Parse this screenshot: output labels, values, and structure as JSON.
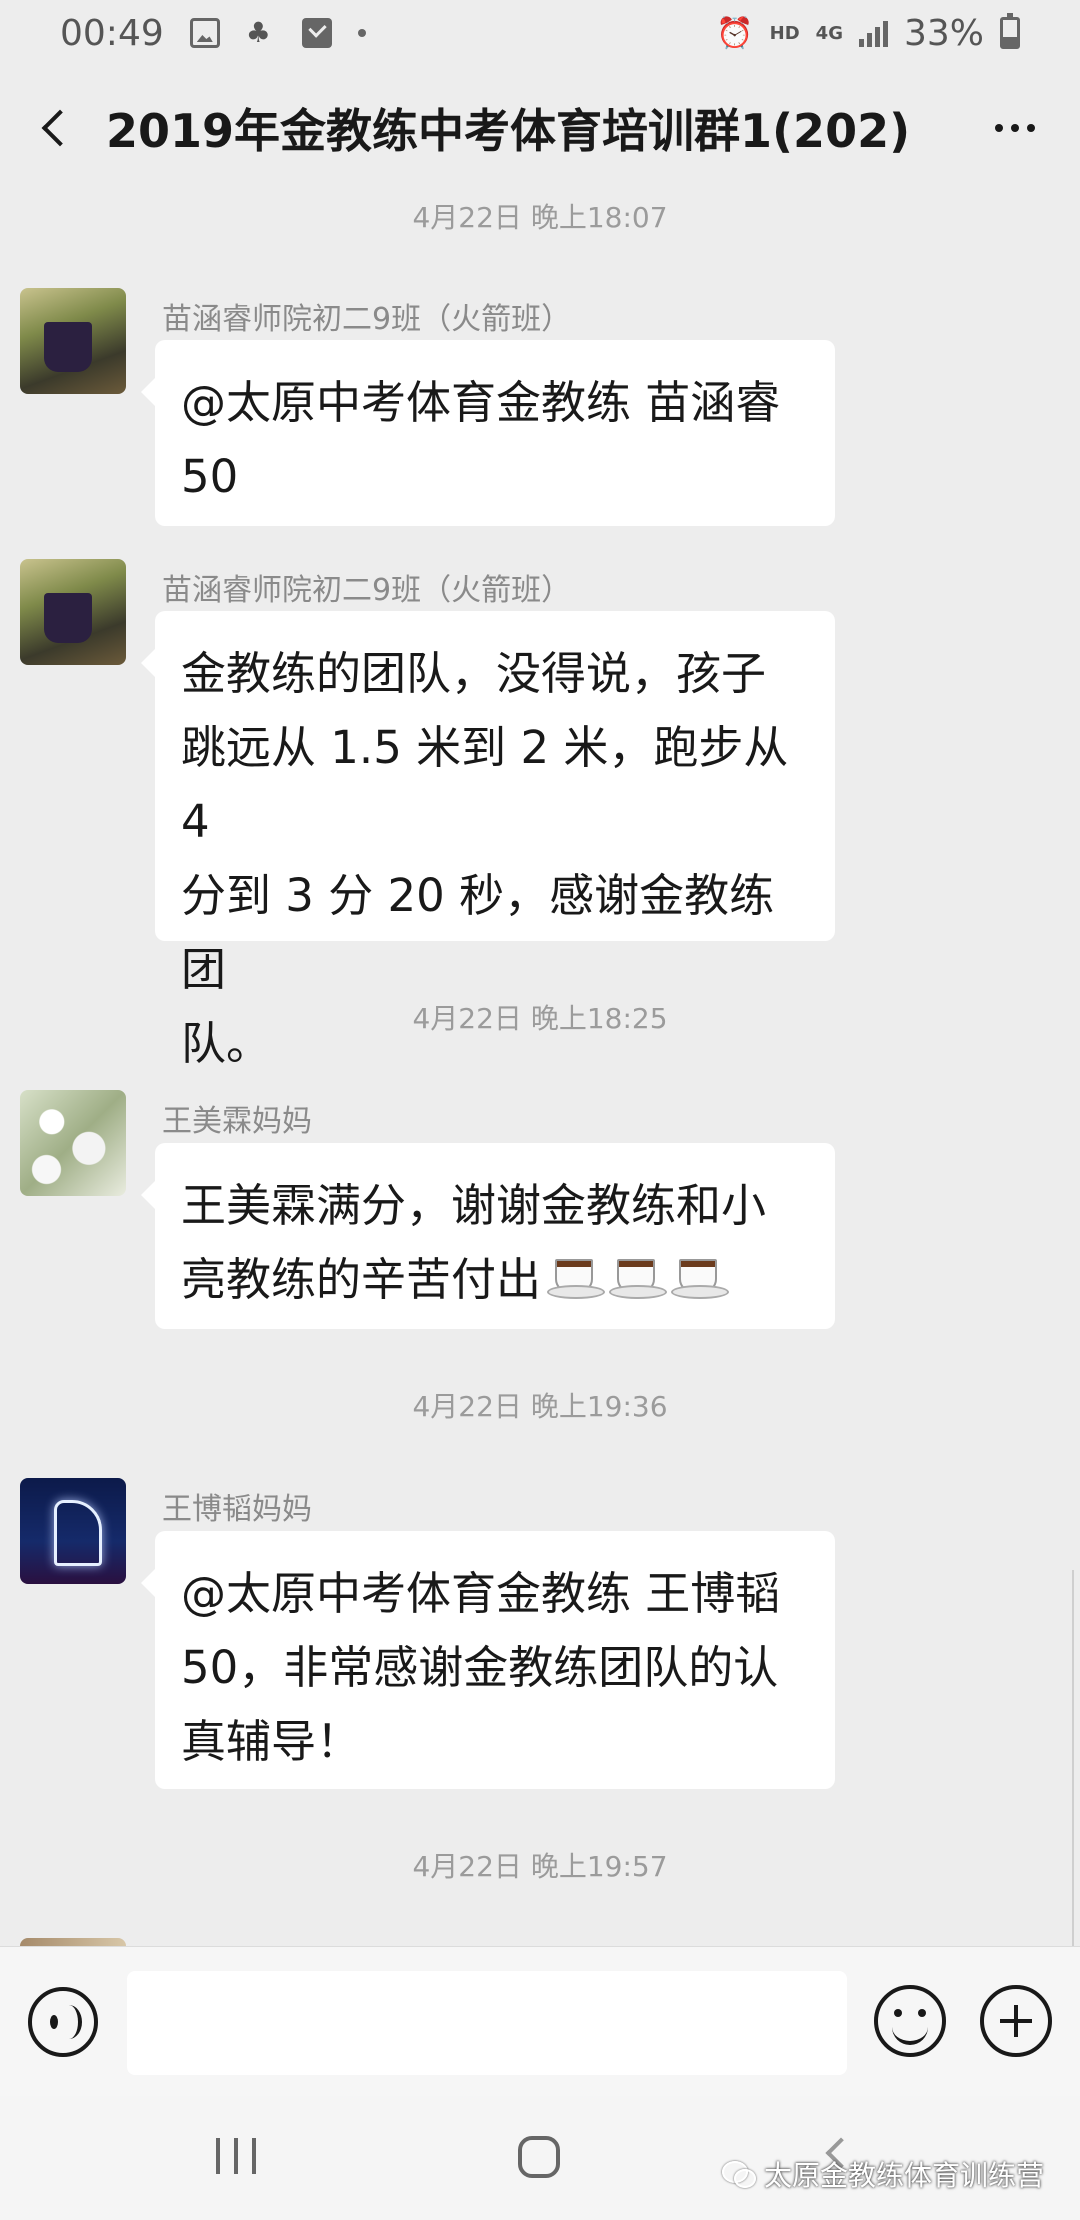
{
  "status_bar": {
    "time": "00:49",
    "hd": "HD",
    "network": "4G",
    "battery": "33%"
  },
  "header": {
    "title": "2019年金教练中考体育培训群1(202)"
  },
  "messages": [
    {
      "type": "time",
      "text": "4月22日 晚上18:07"
    },
    {
      "type": "msg",
      "sender": "苗涵睿师院初二9班（火箭班）",
      "avatar": "cup-avatar",
      "lines": [
        "@太原中考体育金教练  苗涵睿",
        "50"
      ]
    },
    {
      "type": "msg",
      "sender": "苗涵睿师院初二9班（火箭班）",
      "avatar": "cup-avatar",
      "lines": [
        "金教练的团队，没得说，孩子",
        "跳远从 1.5 米到 2 米，跑步从 4",
        "分到 3 分 20 秒，感谢金教练团",
        "队。"
      ]
    },
    {
      "type": "time",
      "text": "4月22日 晚上18:25"
    },
    {
      "type": "msg",
      "sender": "王美霖妈妈",
      "avatar": "flower-avatar",
      "lines": [
        "王美霖满分，谢谢金教练和小",
        "亮教练的辛苦付出"
      ],
      "emoji": "hot-beverage-icon"
    },
    {
      "type": "time",
      "text": "4月22日 晚上19:36"
    },
    {
      "type": "msg",
      "sender": "王博韬妈妈",
      "avatar": "deer-avatar",
      "lines": [
        "@太原中考体育金教练  王博韬",
        "50，非常感谢金教练团队的认",
        "真辅导！"
      ]
    },
    {
      "type": "time",
      "text": "4月22日 晚上19:57"
    }
  ],
  "input_bar": {
    "value": "",
    "placeholder": ""
  },
  "nav_bar": {
    "watermark": "太原金教练体育训练营"
  },
  "colors": {
    "background": "#ededed",
    "bubble": "#ffffff",
    "time_text": "#9b9b9b",
    "sender_text": "#8a8a8a"
  }
}
